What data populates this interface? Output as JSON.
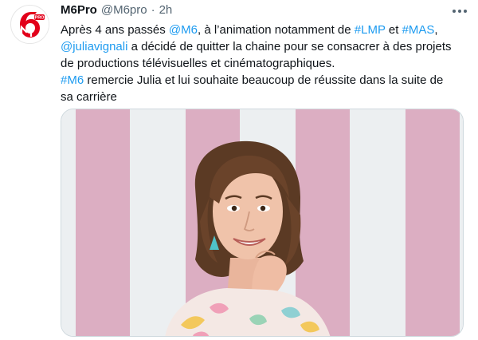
{
  "tweet": {
    "author_name": "M6Pro",
    "author_handle": "@M6pro",
    "separator": "·",
    "timestamp": "2h",
    "avatar_icon": "m6-pro-logo-icon",
    "more_icon": "more-options-icon",
    "text_lines": [
      [
        {
          "t": "Après 4 ans passés ",
          "link": false
        },
        {
          "t": "@M6",
          "link": true
        },
        {
          "t": ", à l’animation notamment de ",
          "link": false
        },
        {
          "t": "#LMP",
          "link": true
        },
        {
          "t": " et ",
          "link": false
        },
        {
          "t": "#MAS",
          "link": true
        },
        {
          "t": ",",
          "link": false
        }
      ],
      [
        {
          "t": "@juliavignali",
          "link": true
        },
        {
          "t": " a décidé de quitter la chaine pour se consacrer à des projets",
          "link": false
        }
      ],
      [
        {
          "t": "de productions télévisuelles et cinématographiques.",
          "link": false
        }
      ],
      [
        {
          "t": " ",
          "link": false
        },
        {
          "t": "#M6",
          "link": true
        },
        {
          "t": " remercie Julia et lui souhaite beaucoup de réussite dans la suite de",
          "link": false
        }
      ],
      [
        {
          "t": "sa carrière",
          "link": false
        }
      ]
    ],
    "media": {
      "kind": "photo",
      "subject": "portrait-photo",
      "background_colors": [
        "#dcaec2",
        "#eceff1"
      ]
    }
  },
  "colors": {
    "link": "#1d9bf0",
    "text": "#0f1419",
    "secondary": "#536471",
    "border": "#cfd9de",
    "logo_red": "#e2001a"
  }
}
